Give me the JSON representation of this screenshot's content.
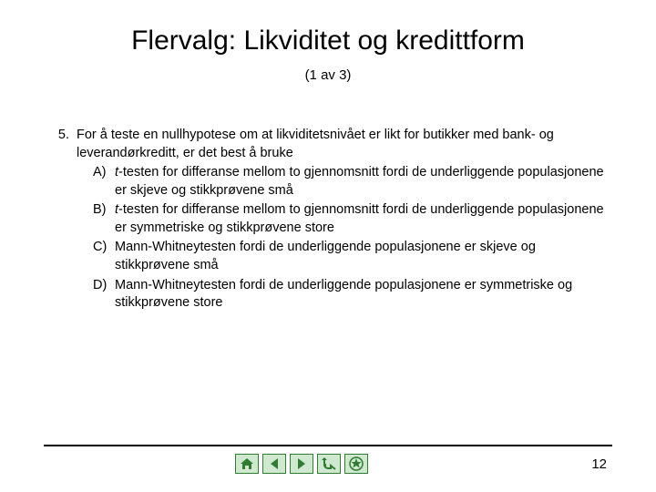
{
  "title": "Flervalg: Likviditet og kredittform",
  "subtitle": "(1 av 3)",
  "question": {
    "number": "5.",
    "stem": "For å teste en nullhypotese om at likviditetsnivået er likt for butikker med bank- og leverandørkreditt, er det best å bruke",
    "options": [
      {
        "label": "A)",
        "italic": "t",
        "rest": "-testen for differanse mellom to gjennomsnitt fordi de underliggende populasjonene er skjeve og stikkprøvene små"
      },
      {
        "label": "B)",
        "italic": "t",
        "rest": "-testen for differanse mellom to gjennomsnitt fordi de underliggende populasjonene er symmetriske og stikkprøvene store"
      },
      {
        "label": "C)",
        "italic": "",
        "rest": "Mann-Whitneytesten fordi de underliggende populasjonene er skjeve og stikkprøvene små"
      },
      {
        "label": "D)",
        "italic": "",
        "rest": "Mann-Whitneytesten fordi de underliggende populasjonene er symmetriske og stikkprøvene store"
      }
    ]
  },
  "page_number": "12",
  "nav_icons": [
    "home-icon",
    "prev-icon",
    "next-icon",
    "return-icon",
    "star-icon"
  ],
  "colors": {
    "nav_fill": "#cfe8cf",
    "nav_stroke": "#2e7d32"
  }
}
